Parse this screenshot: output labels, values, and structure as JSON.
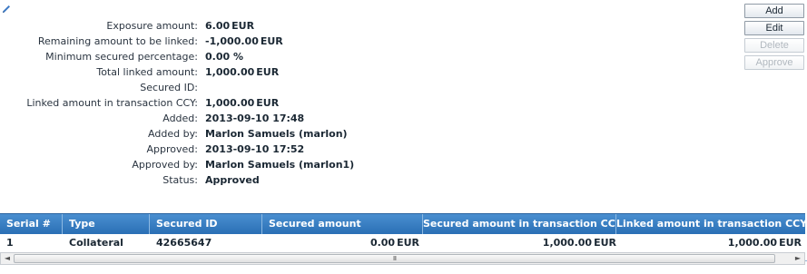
{
  "details": [
    {
      "label": "Exposure amount:",
      "value": "6.00",
      "currency": "EUR"
    },
    {
      "label": "Remaining amount to be linked:",
      "value": "-1,000.00",
      "currency": "EUR"
    },
    {
      "label": "Minimum secured percentage:",
      "value": "0.00 %",
      "currency": ""
    },
    {
      "label": "Total linked amount:",
      "value": "1,000.00",
      "currency": "EUR"
    },
    {
      "label": "Secured ID:",
      "value": "",
      "currency": ""
    },
    {
      "label": "Linked amount in transaction CCY:",
      "value": "1,000.00",
      "currency": "EUR"
    },
    {
      "label": "Added:",
      "value": "2013-09-10 17:48",
      "currency": ""
    },
    {
      "label": "Added by:",
      "value": "Marlon Samuels (marlon)",
      "currency": ""
    },
    {
      "label": "Approved:",
      "value": "2013-09-10 17:52",
      "currency": ""
    },
    {
      "label": "Approved by:",
      "value": "Marlon Samuels (marlon1)",
      "currency": ""
    },
    {
      "label": "Status:",
      "value": "Approved",
      "currency": ""
    }
  ],
  "actions": {
    "add": "Add",
    "edit": "Edit",
    "delete": "Delete",
    "approve": "Approve"
  },
  "grid": {
    "columns": [
      "Serial #",
      "Type",
      "Secured ID",
      "Secured amount",
      "Secured amount in transaction CCY",
      "Linked amount in transaction CCY"
    ],
    "rows": [
      {
        "serial": "1",
        "type": "Collateral",
        "secured_id": "42665647",
        "secured_amount": "0.00",
        "secured_amount_currency": "EUR",
        "secured_amount_txn": "1,000.00",
        "secured_amount_txn_currency": "EUR",
        "linked_amount_txn": "1,000.00",
        "linked_amount_txn_currency": "EUR"
      }
    ]
  },
  "scrollbar": {
    "left_arrow": "◄",
    "right_arrow": "►",
    "grip": "III"
  },
  "colors": {
    "header_bg": "#3a80c4",
    "text": "#1a2733",
    "disabled_text": "#b1b8bf"
  },
  "icons": {
    "edit_link": "pencil-icon"
  }
}
